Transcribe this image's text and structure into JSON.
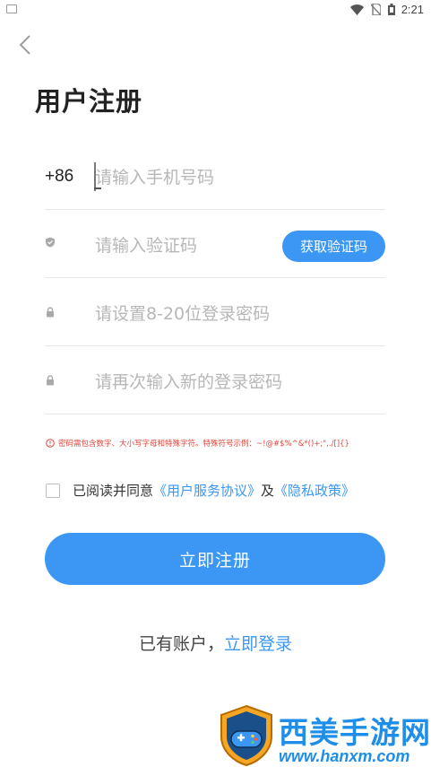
{
  "status_bar": {
    "time": "2:21"
  },
  "page": {
    "title": "用户注册"
  },
  "phone": {
    "prefix": "+86",
    "placeholder": "请输入手机号码"
  },
  "verify": {
    "placeholder": "请输入验证码",
    "button_label": "获取验证码"
  },
  "password": {
    "placeholder": "请设置8-20位登录密码"
  },
  "confirm_password": {
    "placeholder": "请再次输入新的登录密码"
  },
  "hint": {
    "text": "密码需包含数字、大小写字母和特殊字符。特殊符号示例：~!@#$%^&*()+;\",./[]{}"
  },
  "agreement": {
    "prefix": "已阅读并同意",
    "user_agreement": "《用户服务协议》",
    "and": "及",
    "privacy_policy": "《隐私政策》",
    "checked": false
  },
  "register_button": {
    "label": "立即注册"
  },
  "login_prompt": {
    "text": "已有账户，",
    "link": "立即登录"
  },
  "watermark": {
    "title": "西美手游网",
    "url": "www.hanxm.com"
  },
  "colors": {
    "accent": "#3b97f3",
    "error": "#e2453b",
    "placeholder": "#b7b7b7"
  }
}
